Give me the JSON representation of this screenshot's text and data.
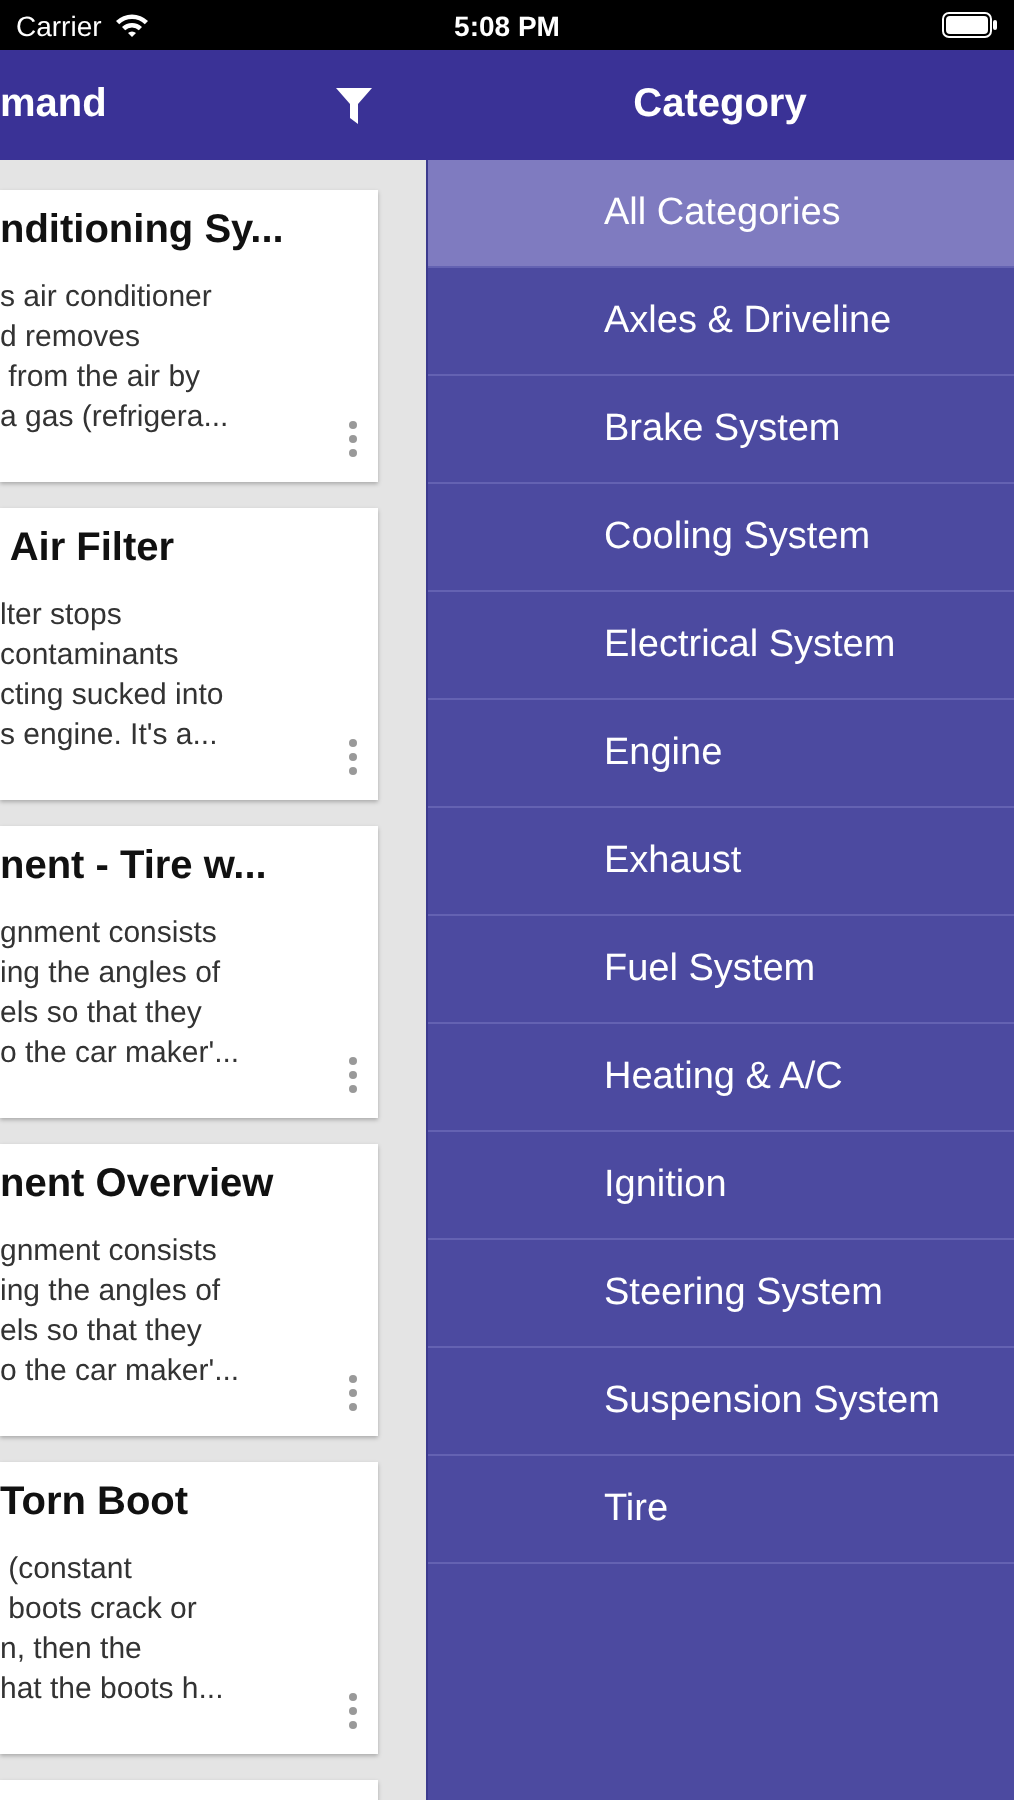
{
  "status_bar": {
    "carrier": "Carrier",
    "time": "5:08 PM"
  },
  "header": {
    "title": "mand",
    "category_title": "Category"
  },
  "cards": [
    {
      "title": "nditioning Sy...",
      "lines": [
        "s air conditioner",
        "d removes",
        " from the air by",
        "a gas (refrigera..."
      ]
    },
    {
      "title": " Air Filter",
      "lines": [
        "lter stops",
        "contaminants",
        "cting sucked into",
        "s engine. It's a..."
      ]
    },
    {
      "title": "nent - Tire w...",
      "lines": [
        "gnment consists",
        "ing the angles of",
        "els so that they",
        "o the car maker'..."
      ]
    },
    {
      "title": "nent Overview",
      "lines": [
        "gnment consists",
        "ing the angles of",
        "els so that they",
        "o the car maker'..."
      ]
    },
    {
      "title": "Torn Boot",
      "lines": [
        " (constant",
        " boots crack or",
        "n, then the",
        "hat the boots h..."
      ]
    }
  ],
  "categories": [
    {
      "label": "All Categories",
      "selected": true
    },
    {
      "label": "Axles & Driveline",
      "selected": false
    },
    {
      "label": "Brake System",
      "selected": false
    },
    {
      "label": "Cooling System",
      "selected": false
    },
    {
      "label": "Electrical System",
      "selected": false
    },
    {
      "label": "Engine",
      "selected": false
    },
    {
      "label": "Exhaust",
      "selected": false
    },
    {
      "label": "Fuel System",
      "selected": false
    },
    {
      "label": "Heating & A/C",
      "selected": false
    },
    {
      "label": "Ignition",
      "selected": false
    },
    {
      "label": "Steering System",
      "selected": false
    },
    {
      "label": "Suspension System",
      "selected": false
    },
    {
      "label": "Tire",
      "selected": false
    }
  ]
}
